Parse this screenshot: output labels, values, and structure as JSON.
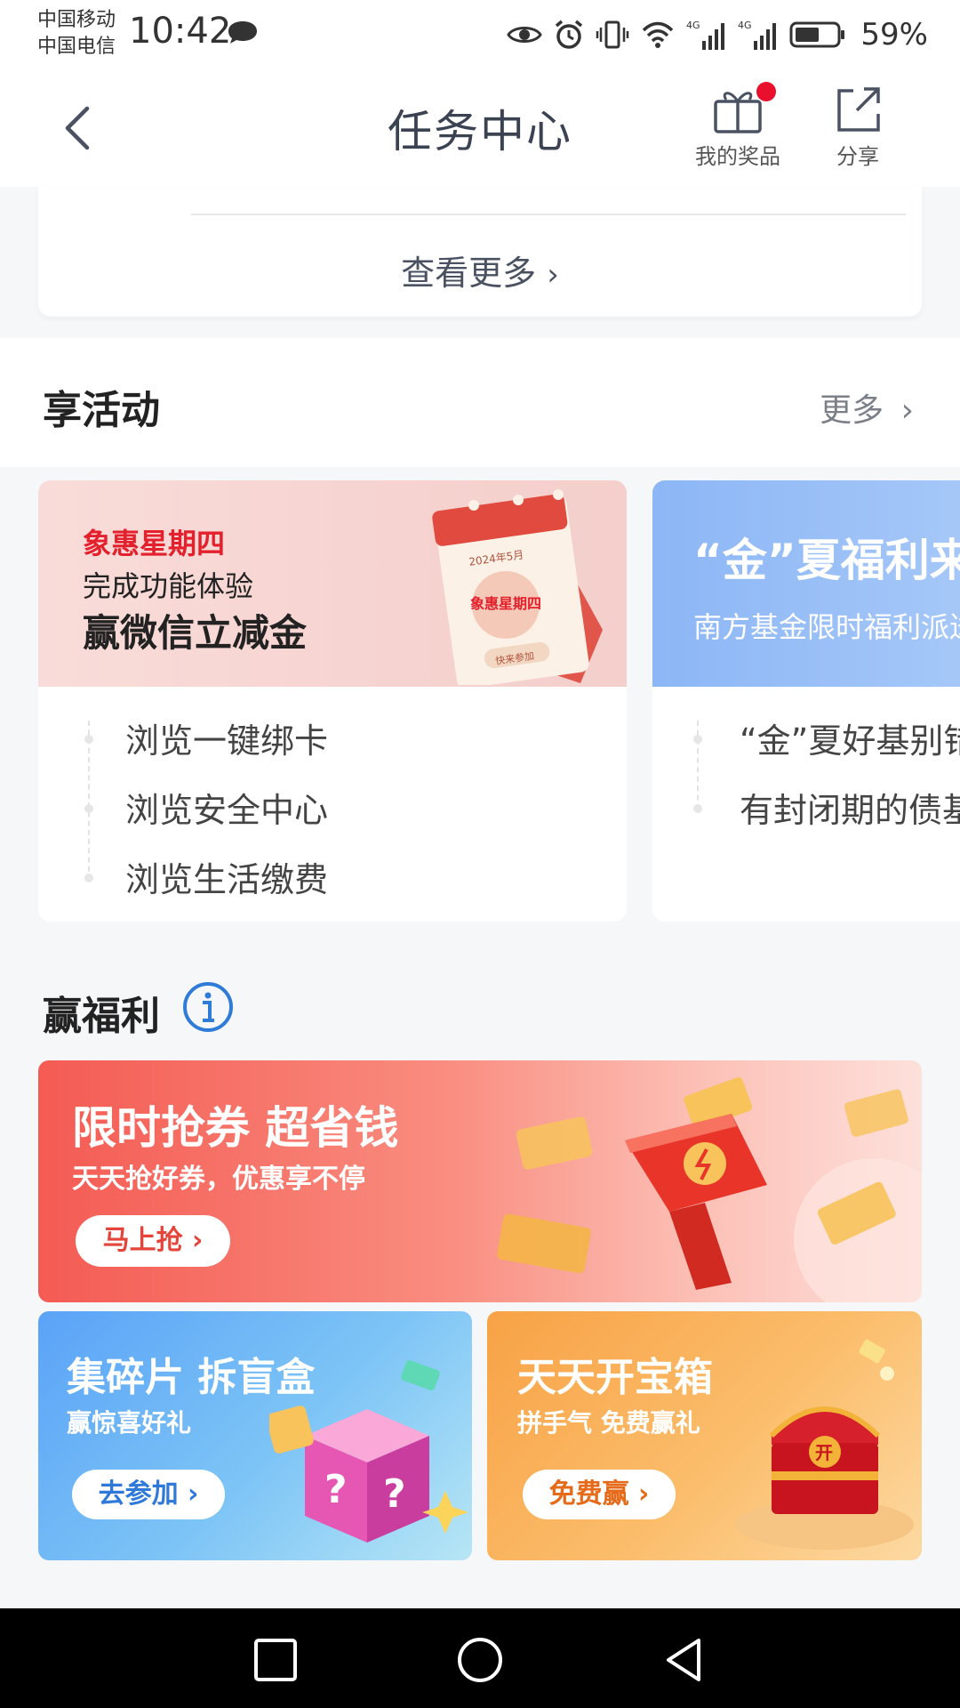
{
  "status_bar": {
    "carrier_1": "中国移动",
    "carrier_2": "中国电信",
    "time": "10:42",
    "battery": "59%",
    "net_1": "4G",
    "net_2": "4G"
  },
  "nav": {
    "title": "任务中心",
    "prizes_label": "我的奖品",
    "share_label": "分享"
  },
  "top_card": {
    "view_more": "查看更多"
  },
  "activities": {
    "title": "享活动",
    "more": "更多",
    "cards": [
      {
        "banner_line1": "象惠星期四",
        "banner_line2": "完成功能体验",
        "banner_line3": "赢微信立减金",
        "calendar_date": "2024年5月",
        "calendar_badge": "象惠星期四",
        "calendar_button": "快来参加",
        "tasks": [
          "浏览一键绑卡",
          "浏览安全中心",
          "浏览生活缴费"
        ]
      },
      {
        "banner_line1": "“金”夏福利来袭",
        "banner_line2": "南方基金限时福利派送",
        "tasks": [
          "“金”夏好基别错过",
          "有封闭期的债基"
        ]
      }
    ]
  },
  "welfare": {
    "title": "赢福利",
    "promos": [
      {
        "title": "限时抢券 超省钱",
        "subtitle": "天天抢好券，优惠享不停",
        "button": "马上抢"
      },
      {
        "title": "集碎片 拆盲盒",
        "subtitle": "赢惊喜好礼",
        "button": "去参加"
      },
      {
        "title": "天天开宝箱",
        "subtitle": "拼手气 免费赢礼",
        "button": "免费赢",
        "chest_label": "开"
      }
    ]
  },
  "colors": {
    "accent_red": "#e3202c",
    "info_blue": "#2f7bd8"
  }
}
